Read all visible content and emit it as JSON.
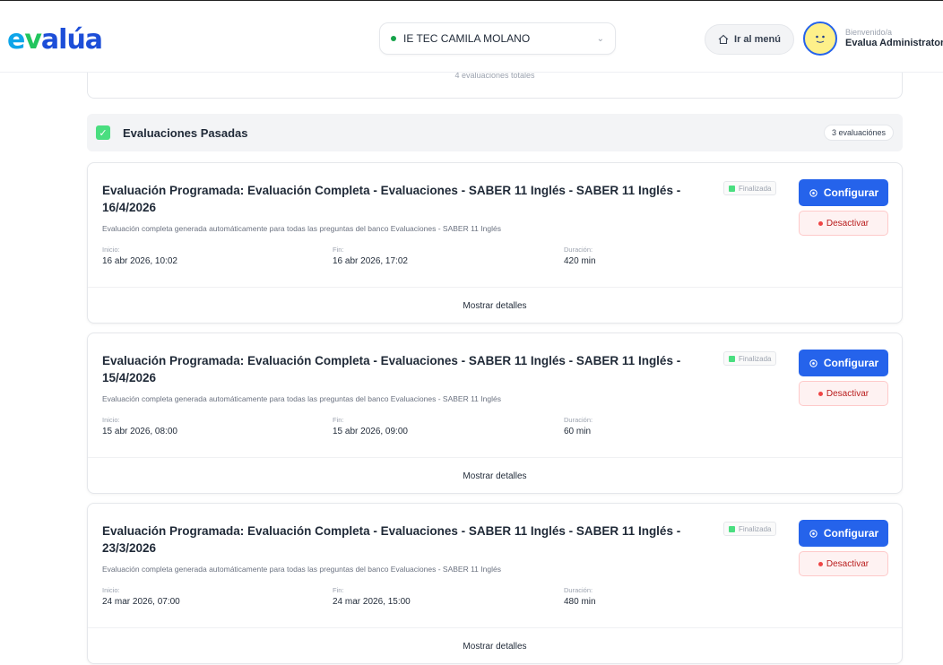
{
  "header": {
    "logo": {
      "e": "e",
      "v": "v",
      "rest": "alúa"
    },
    "school": "IE TEC CAMILA MOLANO",
    "menu_label": "Ir al menú",
    "welcome": "Bienvenido/a",
    "username": "Evalua Administrator"
  },
  "prev_card": {
    "total_text": "4 evaluaciones totales"
  },
  "section": {
    "title": "Evaluaciones Pasadas",
    "count": "3 evaluaciónes"
  },
  "labels": {
    "start": "Inicio:",
    "end": "Fin:",
    "duration": "Duración:",
    "configure": "Configurar",
    "deactivate": "Desactivar",
    "details": "Mostrar detalles"
  },
  "evaluations": [
    {
      "title": "Evaluación Programada: Evaluación Completa - Evaluaciones - SABER 11 Inglés - SABER 11 Inglés - 16/4/2026",
      "description": "Evaluación completa generada automáticamente para todas las preguntas del banco Evaluaciones - SABER 11 Inglés",
      "status": "Finalizada",
      "start": "16 abr 2026, 10:02",
      "end": "16 abr 2026, 17:02",
      "duration": "420 min"
    },
    {
      "title": "Evaluación Programada: Evaluación Completa - Evaluaciones - SABER 11 Inglés - SABER 11 Inglés - 15/4/2026",
      "description": "Evaluación completa generada automáticamente para todas las preguntas del banco Evaluaciones - SABER 11 Inglés",
      "status": "Finalizada",
      "start": "15 abr 2026, 08:00",
      "end": "15 abr 2026, 09:00",
      "duration": "60 min"
    },
    {
      "title": "Evaluación Programada: Evaluación Completa - Evaluaciones - SABER 11 Inglés - SABER 11 Inglés - 23/3/2026",
      "description": "Evaluación completa generada automáticamente para todas las preguntas del banco Evaluaciones - SABER 11 Inglés",
      "status": "Finalizada",
      "start": "24 mar 2026, 07:00",
      "end": "24 mar 2026, 15:00",
      "duration": "480 min"
    }
  ],
  "icons": {
    "school_status": "green-dot-icon",
    "dropdown": "chevron-down-icon",
    "menu": "home-icon",
    "section": "check-icon",
    "configure": "gear-icon",
    "deactivate": "red-dot-icon"
  },
  "colors": {
    "primary": "#2563eb",
    "success": "#4ade80",
    "danger": "#ef4444"
  }
}
